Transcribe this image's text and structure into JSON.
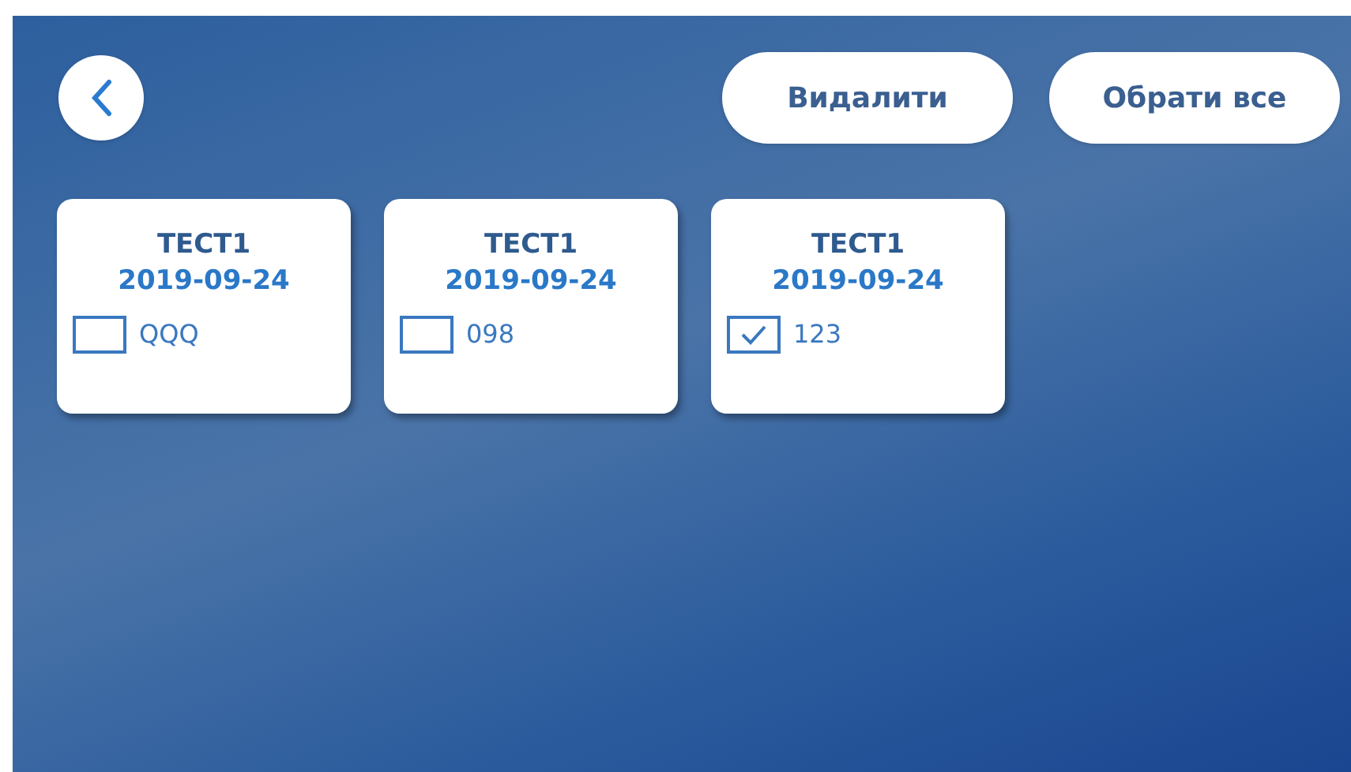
{
  "header": {
    "buttons": [
      "Видалити",
      "Обрати все"
    ]
  },
  "cards": [
    {
      "title": "ТЕСТ1",
      "date": "2019-09-24",
      "label": "QQQ",
      "checked": false
    },
    {
      "title": "ТЕСТ1",
      "date": "2019-09-24",
      "label": "098",
      "checked": false
    },
    {
      "title": "ТЕСТ1",
      "date": "2019-09-24",
      "label": "123",
      "checked": true
    }
  ]
}
